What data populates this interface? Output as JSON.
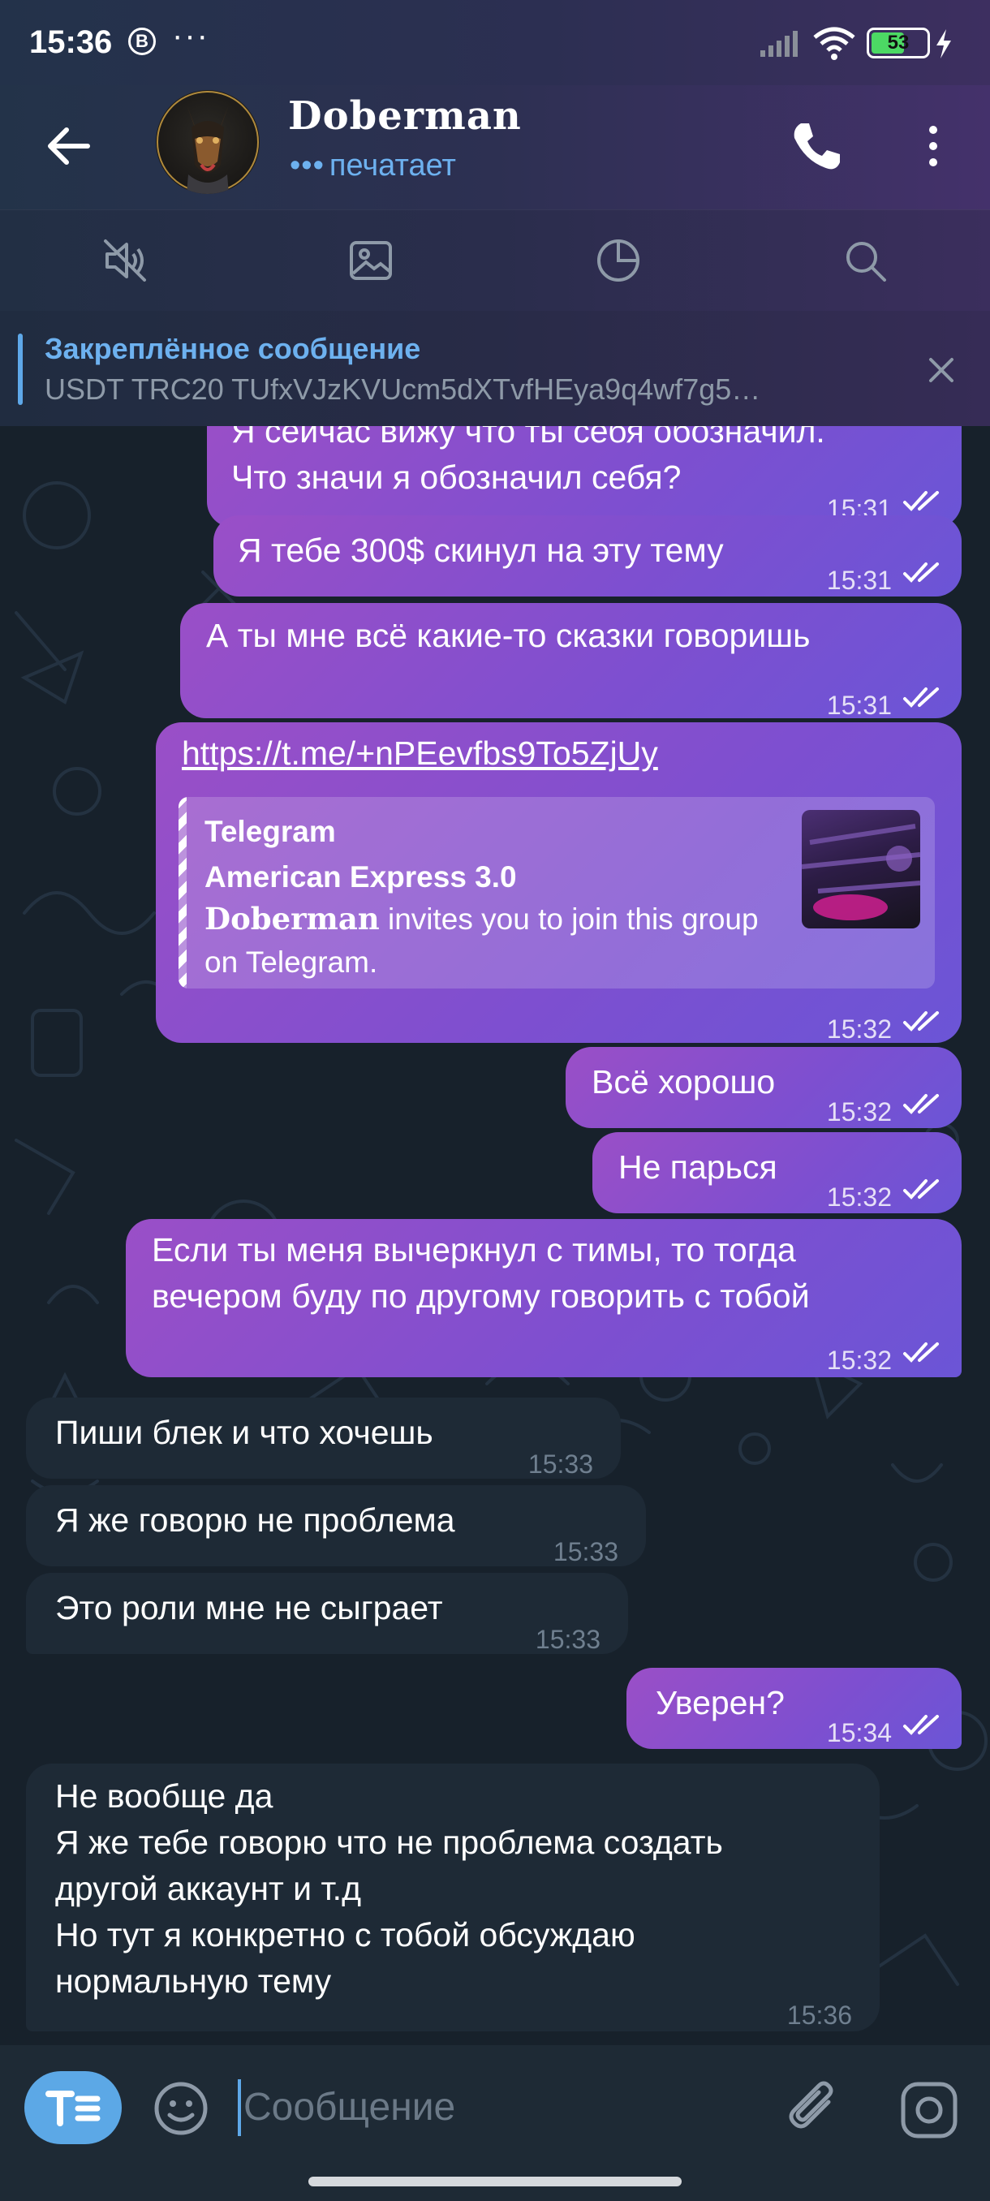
{
  "status_bar": {
    "time": "15:36",
    "notification_badge": "B",
    "more_dots": "···",
    "battery_level": "53"
  },
  "header": {
    "title": "Doberman",
    "status_dots": "•••",
    "status": "печатает"
  },
  "pinned": {
    "title": "Закреплённое сообщение",
    "text": "USDT TRC20  TUfxVJzKVUcm5dXTvfHEya9q4wf7g5…"
  },
  "messages": [
    {
      "dir": "out",
      "text": "Я сейчас вижу что ты себя обозначил.\nЧто значи я обозначил себя?",
      "time": "15:31"
    },
    {
      "dir": "out",
      "text": "Я тебе 300$ скинул на эту тему",
      "time": "15:31"
    },
    {
      "dir": "out",
      "text": "А ты мне всё какие-то сказки говоришь",
      "time": "15:31"
    },
    {
      "dir": "out",
      "link": "https://t.me/+nPEevfbs9To5ZjUy",
      "preview": {
        "site": "Telegram",
        "title": "American Express 3.0",
        "brand": "Doberman",
        "desc": " invites you to join this group on Telegram."
      },
      "time": "15:32"
    },
    {
      "dir": "out",
      "text": "Всё хорошо",
      "time": "15:32"
    },
    {
      "dir": "out",
      "text": "Не парься",
      "time": "15:32"
    },
    {
      "dir": "out",
      "text": "Если ты меня вычеркнул с тимы, то тогда\nвечером буду по другому говорить с тобой",
      "time": "15:32"
    },
    {
      "dir": "in",
      "text": "Пиши блек и что хочешь",
      "time": "15:33"
    },
    {
      "dir": "in",
      "text": "Я же говорю не проблема",
      "time": "15:33"
    },
    {
      "dir": "in",
      "text": "Это роли мне не сыграет",
      "time": "15:33"
    },
    {
      "dir": "out",
      "text": "Уверен?",
      "time": "15:34"
    },
    {
      "dir": "in",
      "text": "Не вообще да\nЯ же тебе говорю что не проблема создать\nдругой аккаунт и т.д\nНо тут я конкретно с тобой обсуждаю\nнормальную тему",
      "time": "15:36"
    }
  ],
  "input": {
    "placeholder": "Сообщение",
    "format_icon": "text-format-icon"
  },
  "colors": {
    "accent": "#5ca8e6",
    "outgoing_bubble": "#8a4fcc",
    "incoming_bubble": "#1e2a36",
    "background": "#17212b"
  }
}
